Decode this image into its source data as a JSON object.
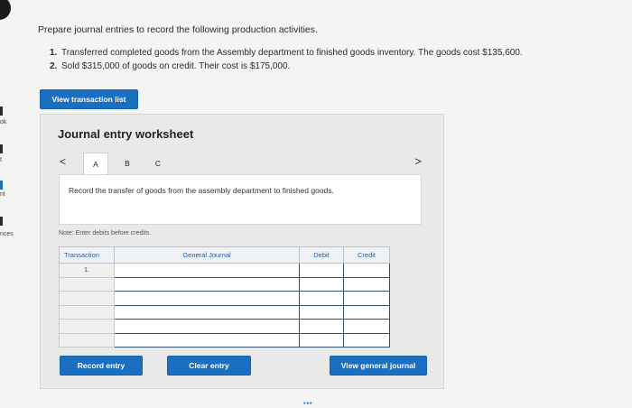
{
  "rail": {
    "items": [
      {
        "label": "ok"
      },
      {
        "label": "t"
      },
      {
        "label": "nt"
      },
      {
        "label": "nces"
      }
    ]
  },
  "question": {
    "prompt": "Prepare journal entries to record the following production activities.",
    "steps": [
      {
        "num": "1.",
        "text": "Transferred completed goods from the Assembly department to finished goods inventory. The goods cost $135,600."
      },
      {
        "num": "2.",
        "text": "Sold $315,000 of goods on credit. Their cost is $175,000."
      }
    ]
  },
  "buttons": {
    "view_transaction_list": "View transaction list",
    "record_entry": "Record entry",
    "clear_entry": "Clear entry",
    "view_general_journal": "View general journal"
  },
  "worksheet": {
    "title": "Journal entry worksheet",
    "nav_prev": "<",
    "nav_next": ">",
    "tabs": [
      "A",
      "B",
      "C"
    ],
    "active_tab": "A",
    "instruction": "Record the transfer of goods from the assembly department to finished goods.",
    "note": "Note: Enter debits before credits."
  },
  "journal_table": {
    "headers": {
      "transaction": "Transaction",
      "general_journal": "General Journal",
      "debit": "Debit",
      "credit": "Credit"
    },
    "rows": [
      {
        "transaction": "1.",
        "account": "",
        "debit": "",
        "credit": ""
      },
      {
        "transaction": "",
        "account": "",
        "debit": "",
        "credit": ""
      },
      {
        "transaction": "",
        "account": "",
        "debit": "",
        "credit": ""
      },
      {
        "transaction": "",
        "account": "",
        "debit": "",
        "credit": ""
      },
      {
        "transaction": "",
        "account": "",
        "debit": "",
        "credit": ""
      },
      {
        "transaction": "",
        "account": "",
        "debit": "",
        "credit": ""
      }
    ]
  },
  "pager": {
    "dots": "•••"
  },
  "colors": {
    "accent": "#1b6fc0",
    "header_text": "#1b5fa7",
    "input_border": "#2f4e70"
  }
}
